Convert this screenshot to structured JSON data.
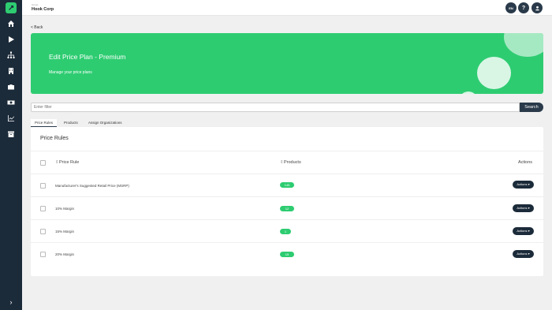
{
  "org": {
    "label": "Group",
    "name": "Hook Corp"
  },
  "topbar": {
    "lang": "EN",
    "help": "?"
  },
  "nav": {
    "back": "< Back",
    "collapse": "›"
  },
  "hero": {
    "title": "Edit Price Plan - Premium",
    "subtitle": "Manage your price plans"
  },
  "filter": {
    "placeholder": "Enter filter",
    "search_label": "Search"
  },
  "tabs": [
    "Price Rules",
    "Products",
    "Assign Organizations"
  ],
  "table": {
    "title": "Price Rules",
    "headers": {
      "rule": "Price Rule",
      "products": "Products",
      "actions": "Actions"
    },
    "sort_marker": "⇕",
    "action_label": "Actions ▾",
    "rows": [
      {
        "name": "Manufacturer's Suggested Retail Price (MSRP)",
        "products": "145"
      },
      {
        "name": "10% Margin",
        "products": "12"
      },
      {
        "name": "15% Margin",
        "products": "1"
      },
      {
        "name": "20% Margin",
        "products": "15"
      }
    ]
  },
  "colors": {
    "accent": "#2ecc71",
    "sidebar": "#1c2b3a",
    "dark_button": "#2a3a4a"
  },
  "icons": [
    "logo-icon",
    "home-icon",
    "play-icon",
    "hierarchy-icon",
    "building-icon",
    "briefcase-icon",
    "money-icon",
    "chart-icon",
    "archive-icon",
    "user-icon"
  ]
}
